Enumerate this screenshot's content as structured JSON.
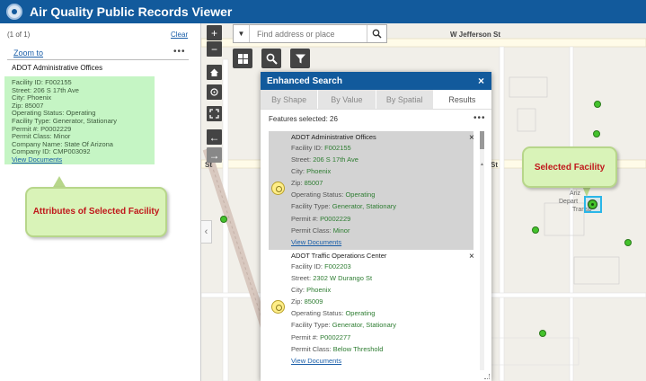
{
  "header": {
    "title": "Air Quality Public Records Viewer"
  },
  "left_panel": {
    "count": "(1 of 1)",
    "clear": "Clear",
    "zoom_to": "Zoom to",
    "more": "•••",
    "feature_title": "ADOT Administrative Offices",
    "attributes": [
      "Facility ID: F002155",
      "Street: 206 S 17th Ave",
      "City: Phoenix",
      "Zip: 85007",
      "Operating Status: Operating",
      "Facility Type: Generator, Stationary",
      "Permit #: P0002229",
      "Permit Class: Minor",
      "Company Name: State Of Arizona",
      "Company ID: CMP003092"
    ],
    "view_documents": "View Documents",
    "callout": "Attributes of Selected Facility"
  },
  "map": {
    "search_placeholder": "Find address or place",
    "streets": {
      "jefferson": "W Jefferson St",
      "st_left": "St",
      "st_right": "St"
    },
    "building_text": [
      "Ariz",
      "Depart",
      "Transp"
    ],
    "selected_callout": "Selected Facility"
  },
  "enhanced_search": {
    "title": "Enhanced Search",
    "close": "×",
    "tabs": [
      "By Shape",
      "By Value",
      "By Spatial",
      "Results"
    ],
    "active_tab": "Results",
    "features_selected": "Features selected: 26",
    "more": "•••",
    "results": [
      {
        "title": "ADOT Administrative Offices",
        "fields": [
          {
            "label": "Facility ID: ",
            "value": "F002155"
          },
          {
            "label": "Street: ",
            "value": "206 S 17th Ave"
          },
          {
            "label": "City: ",
            "value": "Phoenix"
          },
          {
            "label": "Zip: ",
            "value": "85007"
          },
          {
            "label": "Operating Status: ",
            "value": "Operating"
          },
          {
            "label": "Facility Type: ",
            "value": "Generator, Stationary"
          },
          {
            "label": "Permit #: ",
            "value": "P0002229"
          },
          {
            "label": "Permit Class: ",
            "value": "Minor"
          }
        ],
        "link": "View Documents",
        "close": "×"
      },
      {
        "title": "ADOT Traffic Operations Center",
        "fields": [
          {
            "label": "Facility ID: ",
            "value": "F002203"
          },
          {
            "label": "Street: ",
            "value": "2302 W Durango St"
          },
          {
            "label": "City: ",
            "value": "Phoenix"
          },
          {
            "label": "Zip: ",
            "value": "85009"
          },
          {
            "label": "Operating Status: ",
            "value": "Operating"
          },
          {
            "label": "Facility Type: ",
            "value": "Generator, Stationary"
          },
          {
            "label": "Permit #: ",
            "value": "P0002277"
          },
          {
            "label": "Permit Class: ",
            "value": "Below Threshold"
          }
        ],
        "link": "View Documents",
        "close": "×"
      }
    ]
  },
  "colors": {
    "header_bg": "#125a9c",
    "attr_highlight": "#c5f5c4",
    "callout_bg": "#d9f3b8",
    "callout_text": "#c0171b",
    "value_text": "#2e7d32",
    "facility_marker": "#44c22c",
    "selection_outline": "#2ab6e8"
  }
}
